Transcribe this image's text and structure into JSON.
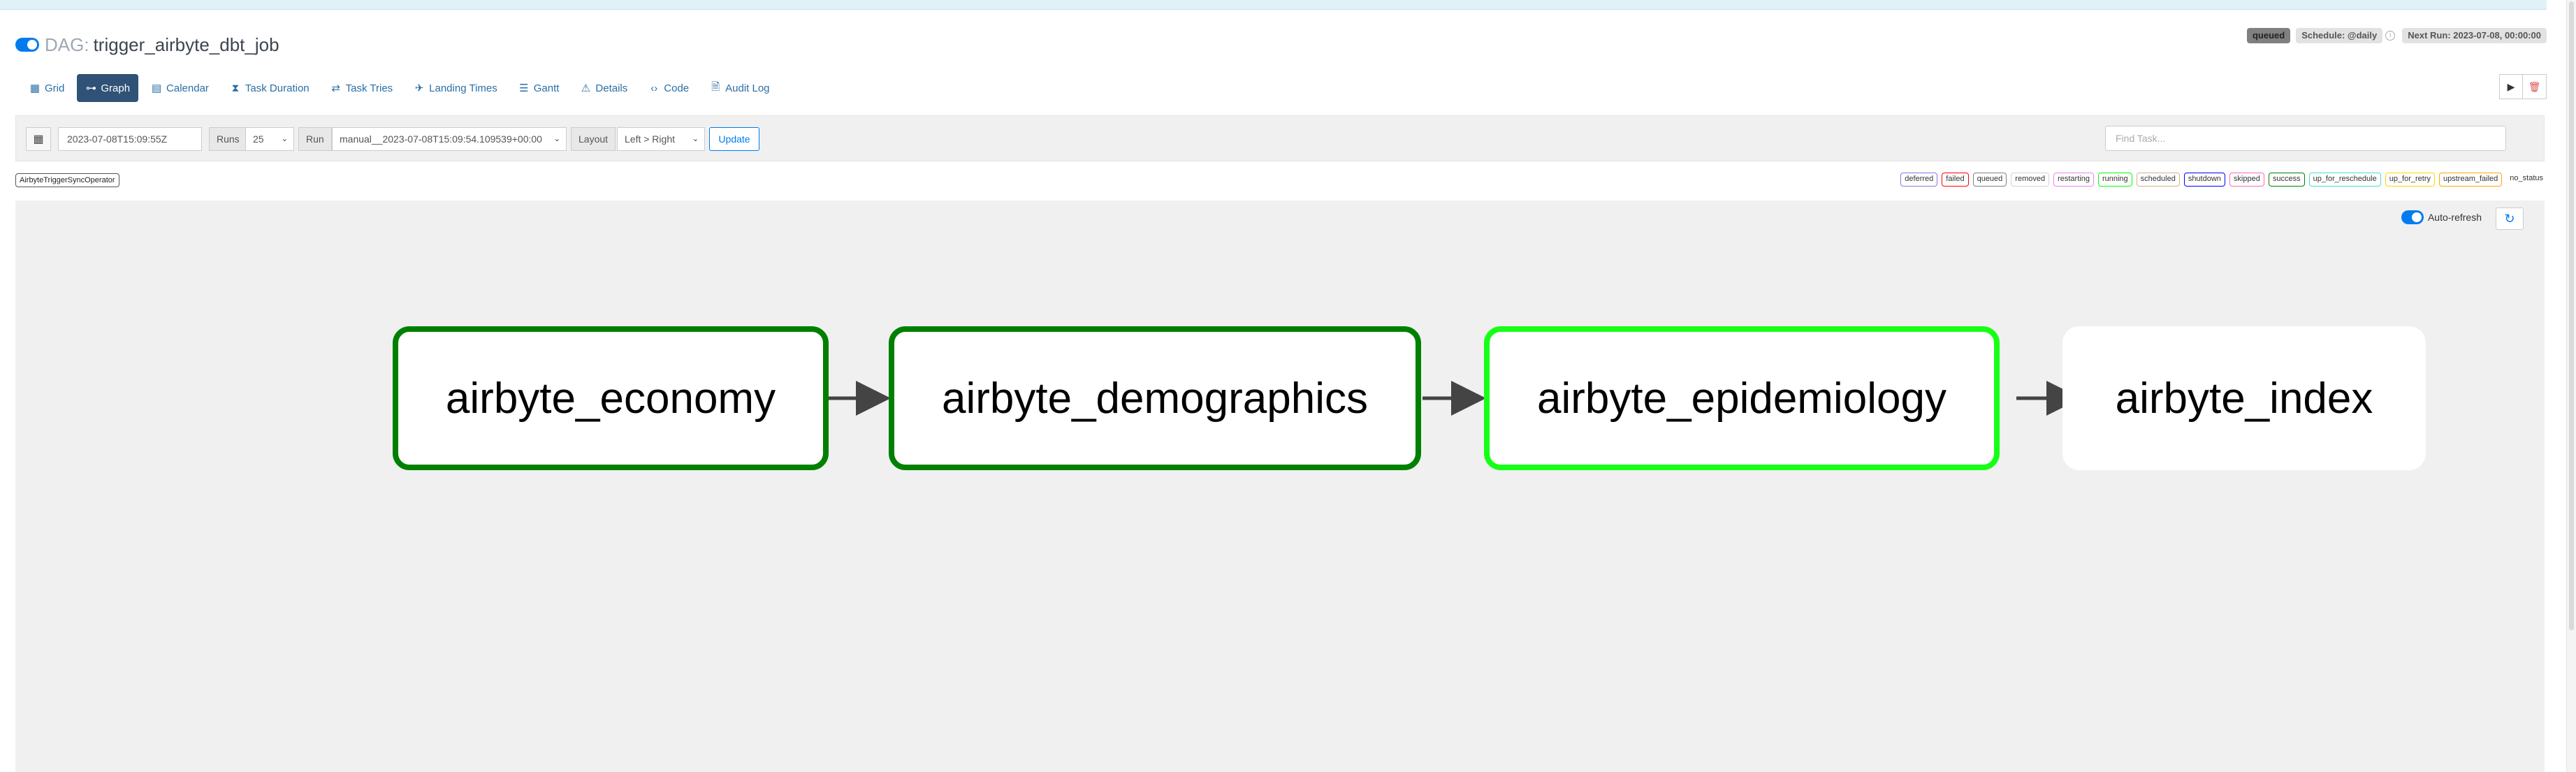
{
  "header": {
    "dag_prefix": "DAG:",
    "dag_id": "trigger_airbyte_dbt_job"
  },
  "status": {
    "state": "queued",
    "schedule": "Schedule: @daily",
    "next_run": "Next Run: 2023-07-08, 00:00:00"
  },
  "nav": {
    "tabs": [
      {
        "label": "Grid",
        "icon": "grid-icon"
      },
      {
        "label": "Graph",
        "icon": "graph-icon",
        "active": true
      },
      {
        "label": "Calendar",
        "icon": "calendar-icon"
      },
      {
        "label": "Task Duration",
        "icon": "hourglass-icon"
      },
      {
        "label": "Task Tries",
        "icon": "retry-icon"
      },
      {
        "label": "Landing Times",
        "icon": "landing-icon"
      },
      {
        "label": "Gantt",
        "icon": "gantt-icon"
      },
      {
        "label": "Details",
        "icon": "details-icon"
      },
      {
        "label": "Code",
        "icon": "code-icon"
      },
      {
        "label": "Audit Log",
        "icon": "audit-icon"
      }
    ]
  },
  "toolbar": {
    "base_date": "2023-07-08T15:09:55Z",
    "runs_label": "Runs",
    "runs_value": "25",
    "run_label": "Run",
    "run_value": "manual__2023-07-08T15:09:54.109539+00:00",
    "layout_label": "Layout",
    "layout_value": "Left > Right",
    "update_label": "Update",
    "find_task_placeholder": "Find Task..."
  },
  "operator": "AirbyteTriggerSyncOperator",
  "legend": [
    {
      "label": "deferred",
      "color": "#9370db"
    },
    {
      "label": "failed",
      "color": "#ff0000"
    },
    {
      "label": "queued",
      "color": "#808080"
    },
    {
      "label": "removed",
      "color": "#d3d3d3"
    },
    {
      "label": "restarting",
      "color": "#ee82ee"
    },
    {
      "label": "running",
      "color": "#00ff00"
    },
    {
      "label": "scheduled",
      "color": "#d2b48c"
    },
    {
      "label": "shutdown",
      "color": "#0000ff"
    },
    {
      "label": "skipped",
      "color": "#ff69b4"
    },
    {
      "label": "success",
      "color": "#008000"
    },
    {
      "label": "up_for_reschedule",
      "color": "#40e0d0"
    },
    {
      "label": "up_for_retry",
      "color": "#ffd700"
    },
    {
      "label": "upstream_failed",
      "color": "#ffa500"
    },
    {
      "label": "no_status",
      "color": ""
    }
  ],
  "graph": {
    "auto_refresh_label": "Auto-refresh",
    "nodes": [
      {
        "label": "airbyte_economy",
        "state": "success"
      },
      {
        "label": "airbyte_demographics",
        "state": "success"
      },
      {
        "label": "airbyte_epidemiology",
        "state": "running"
      },
      {
        "label": "airbyte_index",
        "state": "none"
      }
    ]
  }
}
